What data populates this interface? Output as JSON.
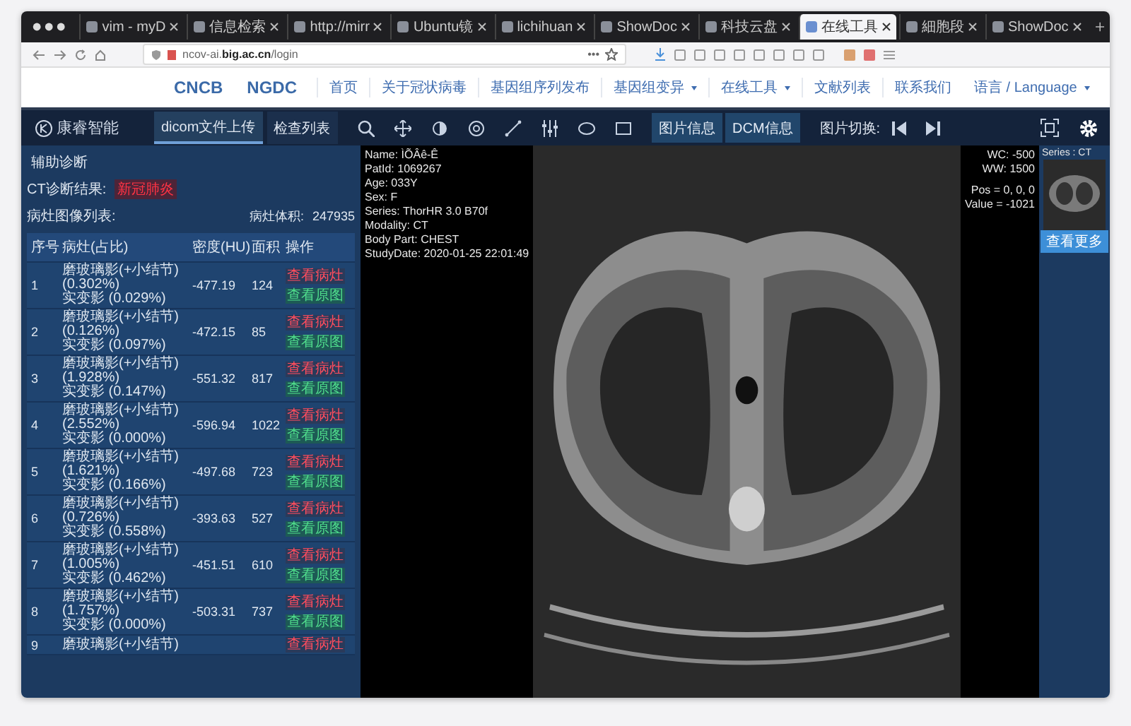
{
  "browser": {
    "tabs": [
      {
        "title": "vim - myD",
        "selected": false
      },
      {
        "title": "信息检索",
        "selected": false
      },
      {
        "title": "http://mirr",
        "selected": false
      },
      {
        "title": "Ubuntu镜",
        "selected": false
      },
      {
        "title": "lichihuan",
        "selected": false
      },
      {
        "title": "ShowDoc",
        "selected": false
      },
      {
        "title": "科技云盘",
        "selected": false
      },
      {
        "title": "在线工具",
        "selected": true
      },
      {
        "title": "細胞段",
        "selected": false
      },
      {
        "title": "ShowDoc",
        "selected": false
      }
    ],
    "url": "ncov-ai.**big.ac.cn**/login",
    "page_actions": "•••"
  },
  "site_nav": {
    "logos": [
      "CNCB",
      "NGDC"
    ],
    "items": [
      {
        "label": "首页",
        "dropdown": false
      },
      {
        "label": "关于冠状病毒",
        "dropdown": false
      },
      {
        "label": "基因组序列发布",
        "dropdown": false
      },
      {
        "label": "基因组变异",
        "dropdown": true
      },
      {
        "label": "在线工具",
        "dropdown": true
      },
      {
        "label": "文献列表",
        "dropdown": false
      },
      {
        "label": "联系我们",
        "dropdown": false
      }
    ],
    "language": {
      "label": "语言 / Language",
      "dropdown": true
    }
  },
  "app": {
    "logo": "康睿智能",
    "buttons": [
      {
        "label": "dicom文件上传",
        "selected": true
      },
      {
        "label": "检查列表",
        "selected": false
      }
    ],
    "info_buttons": [
      "图片信息",
      "DCM信息"
    ],
    "switch_label": "图片切换:"
  },
  "diagnosis": {
    "title": "辅助诊断",
    "result_label": "CT诊断结果:",
    "result_value": "新冠肺炎",
    "list_label": "病灶图像列表:",
    "volume_label": "病灶体积:",
    "volume_value": "247935",
    "columns": [
      "序号",
      "病灶(占比)",
      "密度(HU)",
      "面积",
      "操作"
    ],
    "rows": [
      {
        "index": "1",
        "lesion": "磨玻璃影(+小结节)",
        "share": "(0.302%)",
        "consolidation": "实变影 (0.029%)",
        "density": "-477.19",
        "area": "124",
        "actions": [
          {
            "label": "查看病灶",
            "kind": "lesion"
          },
          {
            "label": "查看原图",
            "kind": "image"
          }
        ]
      },
      {
        "index": "2",
        "lesion": "磨玻璃影(+小结节)",
        "share": "(0.126%)",
        "consolidation": "实变影 (0.097%)",
        "density": "-472.15",
        "area": "85",
        "actions": [
          {
            "label": "查看病灶",
            "kind": "lesion"
          },
          {
            "label": "查看原图",
            "kind": "image"
          }
        ]
      },
      {
        "index": "3",
        "lesion": "磨玻璃影(+小结节)",
        "share": "(1.928%)",
        "consolidation": "实变影 (0.147%)",
        "density": "-551.32",
        "area": "817",
        "actions": [
          {
            "label": "查看病灶",
            "kind": "lesion"
          },
          {
            "label": "查看原图",
            "kind": "image"
          }
        ]
      },
      {
        "index": "4",
        "lesion": "磨玻璃影(+小结节)",
        "share": "(2.552%)",
        "consolidation": "实变影 (0.000%)",
        "density": "-596.94",
        "area": "1022",
        "actions": [
          {
            "label": "查看病灶",
            "kind": "lesion"
          },
          {
            "label": "查看原图",
            "kind": "image"
          }
        ]
      },
      {
        "index": "5",
        "lesion": "磨玻璃影(+小结节)",
        "share": "(1.621%)",
        "consolidation": "实变影 (0.166%)",
        "density": "-497.68",
        "area": "723",
        "actions": [
          {
            "label": "查看病灶",
            "kind": "lesion"
          },
          {
            "label": "查看原图",
            "kind": "image"
          }
        ]
      },
      {
        "index": "6",
        "lesion": "磨玻璃影(+小结节)",
        "share": "(0.726%)",
        "consolidation": "实变影 (0.558%)",
        "density": "-393.63",
        "area": "527",
        "actions": [
          {
            "label": "查看病灶",
            "kind": "lesion"
          },
          {
            "label": "查看原图",
            "kind": "image"
          }
        ]
      },
      {
        "index": "7",
        "lesion": "磨玻璃影(+小结节)",
        "share": "(1.005%)",
        "consolidation": "实变影 (0.462%)",
        "density": "-451.51",
        "area": "610",
        "actions": [
          {
            "label": "查看病灶",
            "kind": "lesion"
          },
          {
            "label": "查看原图",
            "kind": "image"
          }
        ]
      },
      {
        "index": "8",
        "lesion": "磨玻璃影(+小结节)",
        "share": "(1.757%)",
        "consolidation": "实变影 (0.000%)",
        "density": "-503.31",
        "area": "737",
        "actions": [
          {
            "label": "查看病灶",
            "kind": "lesion"
          },
          {
            "label": "查看原图",
            "kind": "image"
          }
        ]
      },
      {
        "index": "9",
        "lesion": "磨玻璃影(+小结节)",
        "actions": [
          {
            "label": "查看病灶",
            "kind": "lesion"
          }
        ]
      }
    ]
  },
  "viewer": {
    "patient_info": [
      "Name:  ÌÕÂê-Ê",
      "PatId:  1069267",
      "Age:  033Y",
      "Sex:  F",
      "Series:  ThorHR 3.0 B70f",
      "Modality:  CT",
      "Body Part:  CHEST",
      "StudyDate:  2020-01-25 22:01:49"
    ],
    "window_info": [
      "WC: -500",
      "WW: 1500",
      "Pos = 0, 0, 0",
      "Value = -1021"
    ],
    "series": {
      "label": "Series : CT",
      "button": "查看更多"
    }
  }
}
